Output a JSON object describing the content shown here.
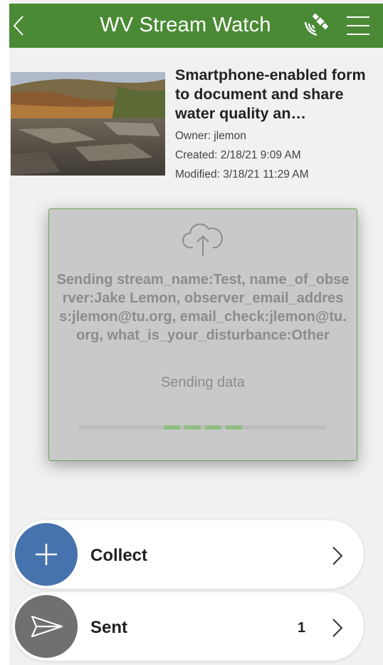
{
  "header": {
    "title": "WV Stream Watch"
  },
  "item": {
    "title": "Smartphone-enabled form to document and share water quality an…",
    "owner": "Owner: jlemon",
    "created": "Created: 2/18/21 9:09 AM",
    "modified": "Modified: 3/18/21 11:29 AM"
  },
  "dialog": {
    "message": "Sending stream_name:Test, name_of_observer:Jake Lemon, observer_email_address:jlemon@tu.org, email_check:jlemon@tu.org, what_is_your_disturbance:Other",
    "status": "Sending data",
    "icon": "cloud-upload-icon"
  },
  "actions": {
    "collect": {
      "label": "Collect",
      "icon": "plus-icon"
    },
    "sent": {
      "label": "Sent",
      "count": "1",
      "icon": "send-icon"
    }
  },
  "colors": {
    "header": "#4a8a35",
    "collect_circle": "#4673ad",
    "sent_circle": "#707070",
    "dialog_border": "#6fa65a",
    "progress": "#8fbf83"
  }
}
